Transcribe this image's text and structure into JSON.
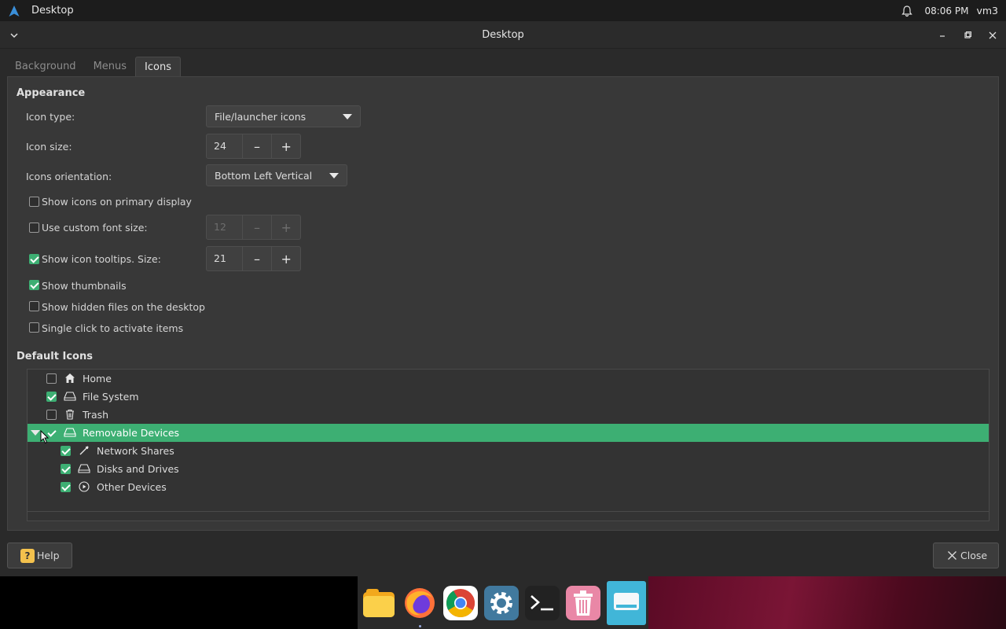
{
  "panel": {
    "app_title": "Desktop",
    "clock": "08:06 PM",
    "user": "vm3"
  },
  "window": {
    "title": "Desktop"
  },
  "tabs": [
    {
      "label": "Background"
    },
    {
      "label": "Menus"
    },
    {
      "label": "Icons"
    }
  ],
  "appearance": {
    "title": "Appearance",
    "icon_type_label": "Icon type:",
    "icon_type_value": "File/launcher icons",
    "icon_size_label": "Icon size:",
    "icon_size_value": "24",
    "orientation_label": "Icons orientation:",
    "orientation_value": "Bottom Left Vertical",
    "show_primary_label": "Show icons on primary display",
    "custom_font_label": "Use custom font size:",
    "custom_font_value": "12",
    "tooltips_label": "Show icon tooltips. Size:",
    "tooltips_value": "21",
    "thumbnails_label": "Show thumbnails",
    "hidden_files_label": "Show hidden files on the desktop",
    "single_click_label": "Single click to activate items"
  },
  "default_icons": {
    "title": "Default Icons",
    "items": [
      {
        "label": "Home"
      },
      {
        "label": "File System"
      },
      {
        "label": "Trash"
      },
      {
        "label": "Removable Devices"
      },
      {
        "label": "Network Shares"
      },
      {
        "label": "Disks and Drives"
      },
      {
        "label": "Other Devices"
      }
    ]
  },
  "buttons": {
    "help": "Help",
    "close": "Close"
  },
  "colors": {
    "accent": "#3daf73",
    "dock_active": "#41b6d8"
  }
}
